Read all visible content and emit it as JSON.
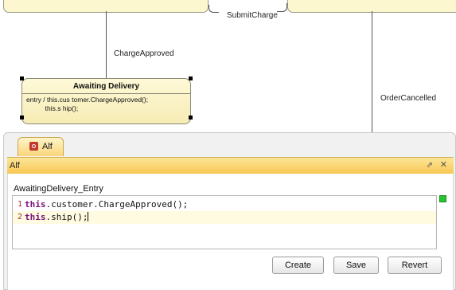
{
  "diagram": {
    "transitions": {
      "submit_charge": "SubmitCharge",
      "charge_approved": "ChargeApproved",
      "order_cancelled": "OrderCancelled"
    },
    "state": {
      "name": "Awaiting Delivery",
      "entry_text": "entry / this.cus tomer.ChargeApproved();\n          this.s hip();"
    }
  },
  "panel": {
    "tab_label": "Alf",
    "header_title": "Alf",
    "restore_glyph": "⇗",
    "close_glyph": "✕",
    "section_label": "AwaitingDelivery_Entry",
    "editor": {
      "lines": [
        {
          "number": "1",
          "keyword": "this",
          "rest": ".customer.ChargeApproved();"
        },
        {
          "number": "2",
          "keyword": "this",
          "rest": ".ship();"
        }
      ]
    },
    "buttons": {
      "create": "Create",
      "save": "Save",
      "revert": "Revert"
    }
  },
  "colors": {
    "state_fill": "#fef9d8",
    "header_accent": "#f8c752",
    "keyword": "#7b0f7b",
    "status_ok": "#27c42f"
  },
  "icons": [
    "alf-tab-icon",
    "restore-icon",
    "close-icon",
    "status-ok-icon"
  ]
}
